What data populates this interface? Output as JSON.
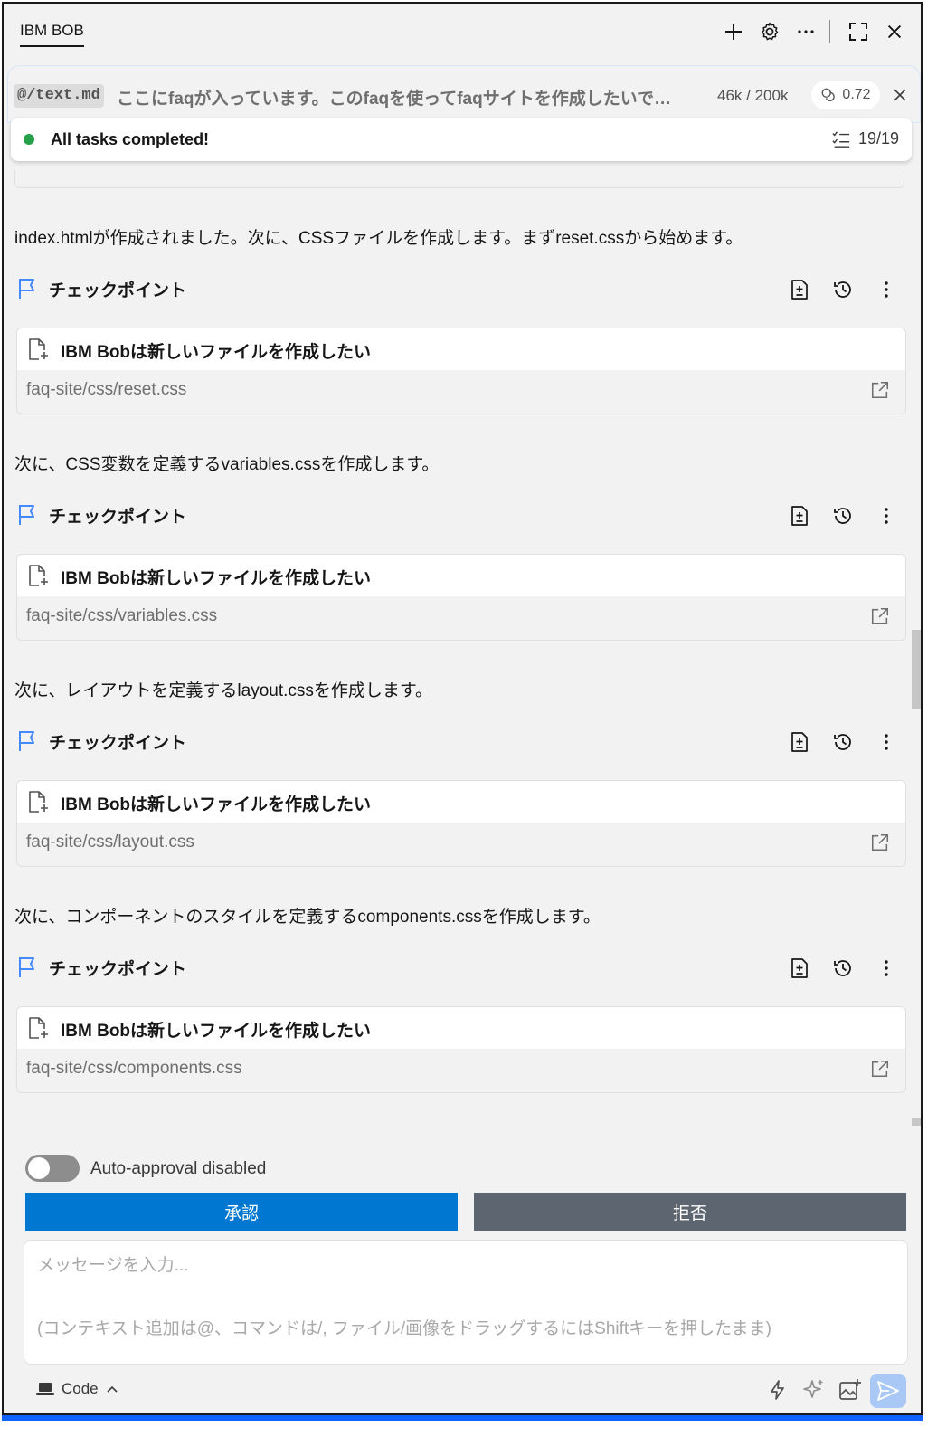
{
  "titlebar": {
    "title": "IBM BOB",
    "icons": [
      "plus-icon",
      "gear-icon",
      "more-horizontal-icon",
      "fullscreen-icon",
      "close-icon"
    ]
  },
  "task": {
    "mention": "@/text.md",
    "text": "ここにfaqが入っています。このfaqを使ってfaqサイトを作成したいで…",
    "tokens": "46k / 200k",
    "cost": "0.72"
  },
  "status": {
    "text": "All tasks completed!",
    "count": "19/19",
    "color": "#24a148"
  },
  "messages": [
    "index.htmlが作成されました。次に、CSSファイルを作成します。まずreset.cssから始めます。",
    "次に、CSS変数を定義するvariables.cssを作成します。",
    "次に、レイアウトを定義するlayout.cssを作成します。",
    "次に、コンポーネントのスタイルを定義するcomponents.cssを作成します。"
  ],
  "checkpoint_label": "チェックポイント",
  "file_cards": [
    {
      "title": "IBM Bobは新しいファイルを作成したい",
      "path": "faq-site/css/reset.css"
    },
    {
      "title": "IBM Bobは新しいファイルを作成したい",
      "path": "faq-site/css/variables.css"
    },
    {
      "title": "IBM Bobは新しいファイルを作成したい",
      "path": "faq-site/css/layout.css"
    },
    {
      "title": "IBM Bobは新しいファイルを作成したい",
      "path": "faq-site/css/components.css"
    }
  ],
  "footer": {
    "auto_approval": "Auto-approval disabled",
    "approve": "承認",
    "reject": "拒否",
    "placeholder": "メッセージを入力...",
    "hint": "(コンテキスト追加は@、コマンドは/, ファイル/画像をドラッグするにはShiftキーを押したまま)",
    "mode": "Code"
  },
  "colors": {
    "accent": "#0077d1",
    "reject": "#5d6570",
    "flag": "#4589ff"
  }
}
